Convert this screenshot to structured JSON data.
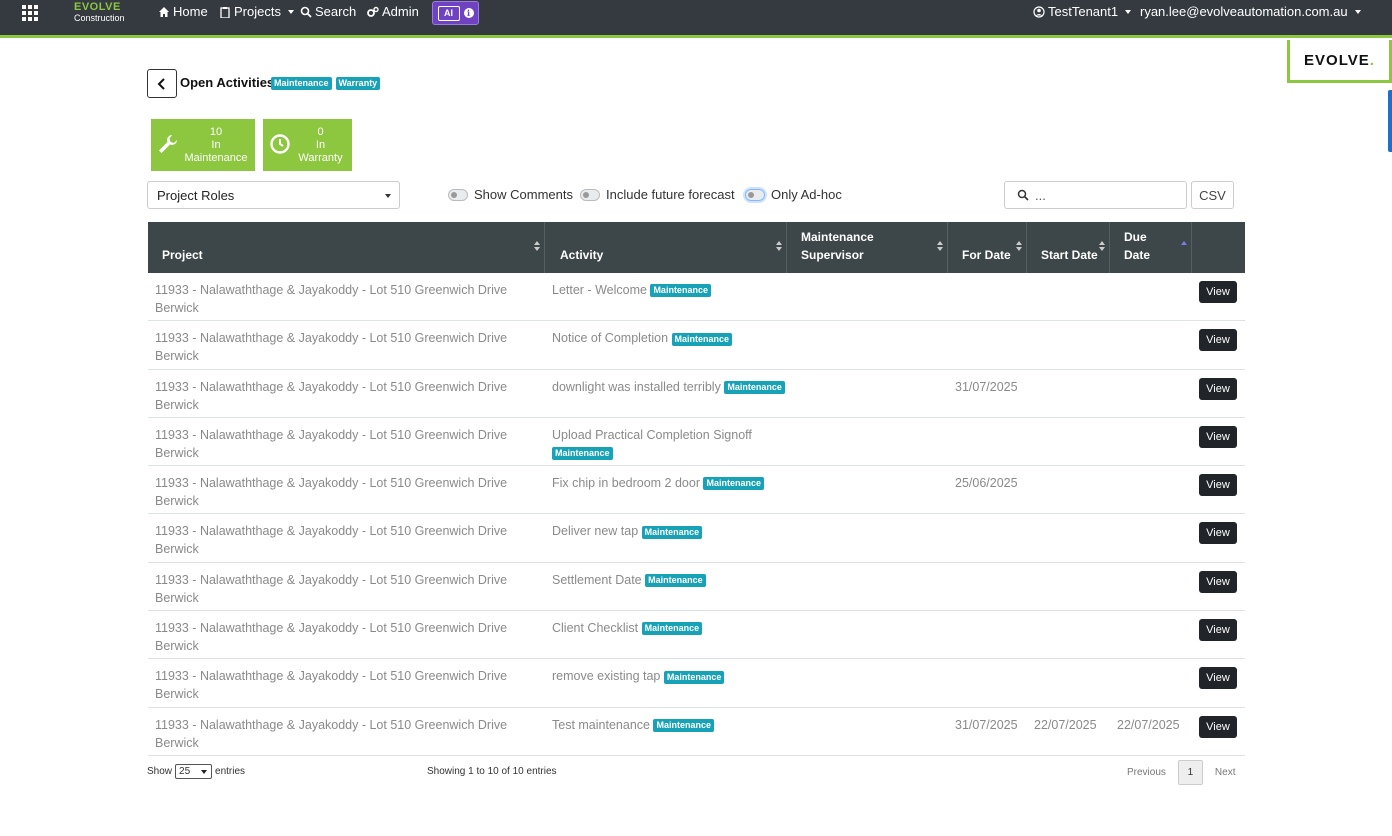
{
  "nav": {
    "brand_top": "EVOLVE",
    "brand_bottom": "Construction",
    "home": "Home",
    "projects": "Projects",
    "search": "Search",
    "admin": "Admin",
    "ai_label": "AI",
    "info": "i",
    "tenant": "TestTenant1",
    "user_email": "ryan.lee@evolveautomation.com.au"
  },
  "logo": {
    "text": "EVOLVE",
    "dot": "."
  },
  "header": {
    "title": "Open Activities",
    "badges": [
      "Maintenance",
      "Warranty"
    ]
  },
  "tiles": [
    {
      "count": "10",
      "line1": "In",
      "line2": "Maintenance"
    },
    {
      "count": "0",
      "line1": "In",
      "line2": "Warranty"
    }
  ],
  "filters": {
    "roles_value": "Project Roles",
    "toggles": [
      "Show Comments",
      "Include future forecast",
      "Only Ad-hoc"
    ],
    "search_placeholder": "...",
    "csv_label": "CSV"
  },
  "table": {
    "columns": [
      {
        "line1": "Project",
        "line2": ""
      },
      {
        "line1": "Activity",
        "line2": ""
      },
      {
        "line1": "Maintenance",
        "line2": "Supervisor"
      },
      {
        "line1": "For Date",
        "line2": ""
      },
      {
        "line1": "Start Date",
        "line2": ""
      },
      {
        "line1": "Due",
        "line2": "Date"
      }
    ],
    "badge": "Maintenance",
    "view_label": "View",
    "rows": [
      {
        "project": "11933 - Nalawaththage & Jayakoddy - Lot 510 Greenwich Drive Berwick",
        "activity": "Letter - Welcome",
        "supervisor": "",
        "for_date": "",
        "start_date": "",
        "due_date": ""
      },
      {
        "project": "11933 - Nalawaththage & Jayakoddy - Lot 510 Greenwich Drive Berwick",
        "activity": "Notice of Completion",
        "supervisor": "",
        "for_date": "",
        "start_date": "",
        "due_date": ""
      },
      {
        "project": "11933 - Nalawaththage & Jayakoddy - Lot 510 Greenwich Drive Berwick",
        "activity": "downlight was installed terribly",
        "supervisor": "",
        "for_date": "31/07/2025",
        "start_date": "",
        "due_date": ""
      },
      {
        "project": "11933 - Nalawaththage & Jayakoddy - Lot 510 Greenwich Drive Berwick",
        "activity": "Upload Practical Completion Signoff",
        "supervisor": "",
        "for_date": "",
        "start_date": "",
        "due_date": ""
      },
      {
        "project": "11933 - Nalawaththage & Jayakoddy - Lot 510 Greenwich Drive Berwick",
        "activity": "Fix chip in bedroom 2 door",
        "supervisor": "",
        "for_date": "25/06/2025",
        "start_date": "",
        "due_date": ""
      },
      {
        "project": "11933 - Nalawaththage & Jayakoddy - Lot 510 Greenwich Drive Berwick",
        "activity": "Deliver new tap",
        "supervisor": "",
        "for_date": "",
        "start_date": "",
        "due_date": ""
      },
      {
        "project": "11933 - Nalawaththage & Jayakoddy - Lot 510 Greenwich Drive Berwick",
        "activity": "Settlement Date",
        "supervisor": "",
        "for_date": "",
        "start_date": "",
        "due_date": ""
      },
      {
        "project": "11933 - Nalawaththage & Jayakoddy - Lot 510 Greenwich Drive Berwick",
        "activity": "Client Checklist",
        "supervisor": "",
        "for_date": "",
        "start_date": "",
        "due_date": ""
      },
      {
        "project": "11933 - Nalawaththage & Jayakoddy - Lot 510 Greenwich Drive Berwick",
        "activity": "remove existing tap",
        "supervisor": "",
        "for_date": "",
        "start_date": "",
        "due_date": ""
      },
      {
        "project": "11933 - Nalawaththage & Jayakoddy - Lot 510 Greenwich Drive Berwick",
        "activity": "Test maintenance",
        "supervisor": "",
        "for_date": "31/07/2025",
        "start_date": "22/07/2025",
        "due_date": "22/07/2025"
      }
    ]
  },
  "footer": {
    "show_label": "Show",
    "entries_value": "25",
    "entries_label": "entries",
    "showing": "Showing 1 to 10 of 10 entries",
    "previous": "Previous",
    "page": "1",
    "next": "Next"
  },
  "colors": {
    "navbar": "#343a40",
    "accent_green": "#8dc63f",
    "badge_teal": "#17a2b8",
    "table_header": "#3d4648",
    "ai_purple": "#6f42c1"
  }
}
